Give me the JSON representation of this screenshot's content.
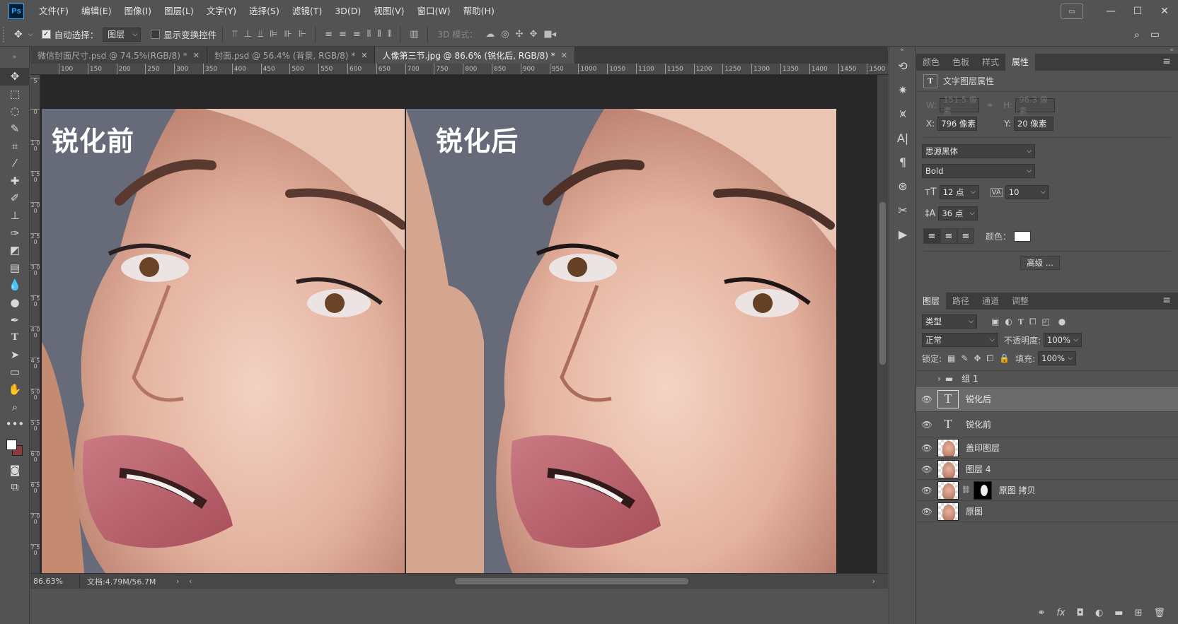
{
  "app": {
    "logo": "Ps"
  },
  "menu": [
    "文件(F)",
    "编辑(E)",
    "图像(I)",
    "图层(L)",
    "文字(Y)",
    "选择(S)",
    "滤镜(T)",
    "3D(D)",
    "视图(V)",
    "窗口(W)",
    "帮助(H)"
  ],
  "options": {
    "auto_select_label": "自动选择：",
    "auto_select_checked": true,
    "auto_select_value": "图层",
    "show_transform_label": "显示变换控件",
    "show_transform_checked": false,
    "mode_3d_label": "3D 模式："
  },
  "tabs": [
    {
      "label": "微信封面尺寸.psd @ 74.5%(RGB/8) *",
      "active": false
    },
    {
      "label": "封面.psd @ 56.4% (背景, RGB/8) *",
      "active": false
    },
    {
      "label": "人像第三节.jpg @ 86.6% (锐化后, RGB/8) *",
      "active": true
    }
  ],
  "hruler_labels": [
    "100",
    "150",
    "200",
    "250",
    "300",
    "350",
    "400",
    "450",
    "500",
    "550",
    "600",
    "650",
    "700",
    "750",
    "800",
    "850",
    "900",
    "950",
    "1000",
    "1050",
    "1100",
    "1150",
    "1200",
    "1250",
    "1300",
    "1350",
    "1400",
    "1450",
    "1500",
    "15"
  ],
  "vruler_labels": [
    "5",
    "0",
    "1 0 0",
    "1 5 0",
    "2 0 0",
    "2 5 0",
    "3 0 0",
    "3 5 0",
    "4 0 0",
    "4 5 0",
    "5 0 0",
    "5 5 0",
    "6 0 0",
    "6 5 0",
    "7 0 0",
    "7 5 0"
  ],
  "canvas": {
    "left_label": "锐化前",
    "right_label": "锐化后"
  },
  "status": {
    "zoom": "86.63%",
    "doc": "文档:4.79M/56.7M"
  },
  "props_panel": {
    "tabs": [
      "颜色",
      "色板",
      "样式",
      "属性"
    ],
    "active_tab": "属性",
    "title": "文字图层属性",
    "w_label": "W:",
    "w_value": "151.5 像素",
    "h_label": "H:",
    "h_value": "96.3 像素",
    "x_label": "X:",
    "x_value": "796 像素",
    "y_label": "Y:",
    "y_value": "20 像素",
    "font_family": "思源黑体",
    "font_style": "Bold",
    "font_size": "12 点",
    "tracking": "10",
    "leading": "36 点",
    "color_label": "颜色：",
    "text_color": "#ffffff",
    "advanced_button": "高级 ..."
  },
  "layers_panel": {
    "tabs": [
      "图层",
      "路径",
      "通道",
      "调整"
    ],
    "active_tab": "图层",
    "filter_value": "类型",
    "blend_mode": "正常",
    "opacity_label": "不透明度:",
    "opacity_value": "100%",
    "lock_label": "锁定:",
    "fill_label": "填充:",
    "fill_value": "100%",
    "layers": [
      {
        "name": "组 1",
        "kind": "group",
        "visible": false,
        "selected": false
      },
      {
        "name": "锐化后",
        "kind": "text",
        "visible": true,
        "selected": true
      },
      {
        "name": "锐化前",
        "kind": "text",
        "visible": true,
        "selected": false
      },
      {
        "name": "盖印图层",
        "kind": "pixel",
        "visible": true,
        "selected": false
      },
      {
        "name": "图层 4",
        "kind": "pixel",
        "visible": true,
        "selected": false
      },
      {
        "name": "原图 拷贝",
        "kind": "masked",
        "visible": true,
        "selected": false
      },
      {
        "name": "原图",
        "kind": "pixel",
        "visible": true,
        "selected": false
      }
    ]
  },
  "colors": {
    "accent": "#31a8ff",
    "bg_swatch": "#8c3a3a",
    "fg_swatch": "#ffffff"
  }
}
